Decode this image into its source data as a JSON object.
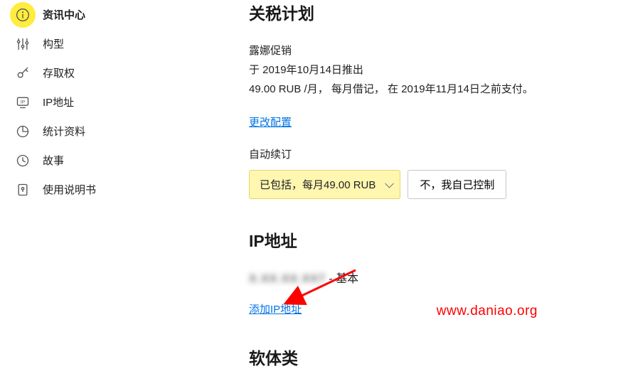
{
  "sidebar": [
    {
      "icon": "info-icon",
      "label": "资讯中心",
      "active": true
    },
    {
      "icon": "sliders-icon",
      "label": "构型",
      "active": false
    },
    {
      "icon": "key-icon",
      "label": "存取权",
      "active": false
    },
    {
      "icon": "ip-icon",
      "label": "IP地址",
      "active": false
    },
    {
      "icon": "stats-icon",
      "label": "统计资料",
      "active": false
    },
    {
      "icon": "clock-icon",
      "label": "故事",
      "active": false
    },
    {
      "icon": "manual-icon",
      "label": "使用说明书",
      "active": false
    }
  ],
  "main": {
    "tariff_title": "关税计划",
    "promo_name": "露娜促销",
    "promo_launch": "于 2019年10月14日推出",
    "promo_price": "49.00 RUB /月， 每月借记， 在 2019年11月14日之前支付。",
    "change_config": "更改配置",
    "auto_renew_label": "自动续订",
    "dropdown_value": "已包括，每月49.00 RUB",
    "self_control": "不，我自己控制",
    "ip_section_title": "IP地址",
    "ip_masked": "X.XX.XX.XX7",
    "ip_suffix": "- 基本",
    "add_ip_link": "添加IP地址",
    "software_title": "软体类"
  },
  "watermark": "www.daniao.org"
}
